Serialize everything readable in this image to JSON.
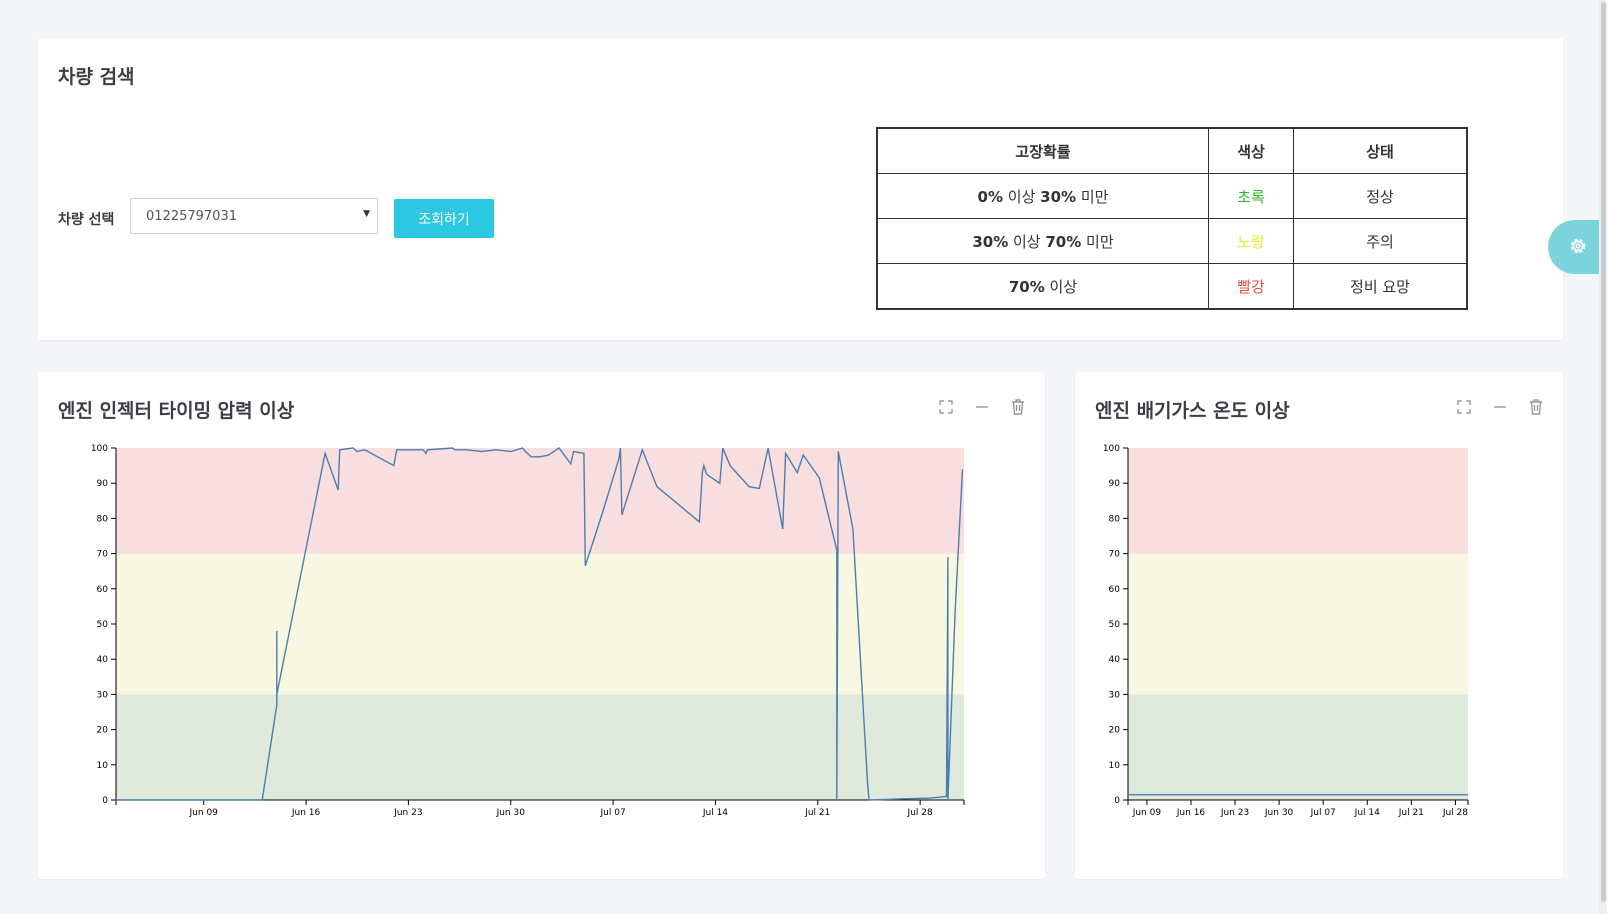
{
  "search": {
    "title": "차량 검색",
    "select_label": "차량 선택",
    "selected_vehicle": "01225797031",
    "query_button": "조회하기"
  },
  "status_table": {
    "headers": [
      "고장확률",
      "색상",
      "상태"
    ],
    "rows": [
      {
        "pre": "",
        "a": "0%",
        "mid": " 이상 ",
        "b": "30%",
        "post": " 미만",
        "color_label": "초록",
        "color": "#2fb82f",
        "state": "정상"
      },
      {
        "pre": "",
        "a": "30%",
        "mid": " 이상 ",
        "b": "70%",
        "post": " 미만",
        "color_label": "노랑",
        "color": "#e8e82a",
        "state": "주의"
      },
      {
        "pre": "",
        "a": "70%",
        "mid": " 이상",
        "b": "",
        "post": "",
        "color_label": "빨강",
        "color": "#e84b4b",
        "state": "정비 요망"
      }
    ]
  },
  "charts": [
    {
      "title": "엔진 인젝터 타이밍 압력 이상"
    },
    {
      "title": "엔진 배기가스 온도 이상"
    }
  ],
  "chart_data": [
    {
      "type": "line",
      "title": "엔진 인젝터 타이밍 압력 이상",
      "ylim": [
        0,
        100
      ],
      "yticks": [
        0,
        10,
        20,
        30,
        40,
        50,
        60,
        70,
        80,
        90,
        100
      ],
      "xlim": [
        "2018-06-03",
        "2018-07-31"
      ],
      "xticks": [
        "Jun 09",
        "Jun 16",
        "Jun 23",
        "Jun 30",
        "Jul 07",
        "Jul 14",
        "Jul 21",
        "Jul 28"
      ],
      "bands": [
        {
          "from": 0,
          "to": 30,
          "color": "#dfeadc"
        },
        {
          "from": 30,
          "to": 70,
          "color": "#f8f8e2"
        },
        {
          "from": 70,
          "to": 100,
          "color": "#f8dede"
        }
      ],
      "line_color": "#4a7fb0",
      "points": [
        [
          "2018-06-03",
          0
        ],
        [
          "2018-06-13",
          0
        ],
        [
          "2018-06-14",
          27
        ],
        [
          "2018-06-14",
          48
        ],
        [
          "2018-06-14",
          30
        ],
        [
          "2018-06-17.3",
          98.5
        ],
        [
          "2018-06-18.2",
          88
        ],
        [
          "2018-06-18.3",
          99.5
        ],
        [
          "2018-06-19.2",
          100
        ],
        [
          "2018-06-19.5",
          99
        ],
        [
          "2018-06-20",
          99.5
        ],
        [
          "2018-06-22",
          95
        ],
        [
          "2018-06-22.2",
          99.5
        ],
        [
          "2018-06-24",
          99.5
        ],
        [
          "2018-06-24.2",
          98.5
        ],
        [
          "2018-06-24.3",
          99.5
        ],
        [
          "2018-06-26",
          100
        ],
        [
          "2018-06-26.2",
          99.5
        ],
        [
          "2018-06-27",
          99.5
        ],
        [
          "2018-06-28",
          99
        ],
        [
          "2018-06-29",
          99.5
        ],
        [
          "2018-06-30",
          99
        ],
        [
          "2018-06-30.8",
          100
        ],
        [
          "2018-07-01",
          99
        ],
        [
          "2018-07-01.4",
          97.5
        ],
        [
          "2018-07-02",
          97.5
        ],
        [
          "2018-07-02.6",
          98
        ],
        [
          "2018-07-03.3",
          100
        ],
        [
          "2018-07-04.1",
          95.5
        ],
        [
          "2018-07-04.3",
          99
        ],
        [
          "2018-07-05",
          98.5
        ],
        [
          "2018-07-05.1",
          66.5
        ],
        [
          "2018-07-06.3",
          82
        ],
        [
          "2018-07-07.4",
          97
        ],
        [
          "2018-07-07.5",
          100
        ],
        [
          "2018-07-07.6",
          81
        ],
        [
          "2018-07-09",
          99.5
        ],
        [
          "2018-07-10",
          89
        ],
        [
          "2018-07-12.9",
          79
        ],
        [
          "2018-07-13.1",
          93
        ],
        [
          "2018-07-13.2",
          95
        ],
        [
          "2018-07-13.4",
          92.5
        ],
        [
          "2018-07-14.3",
          90
        ],
        [
          "2018-07-14.5",
          100
        ],
        [
          "2018-07-15",
          95
        ],
        [
          "2018-07-16.3",
          89
        ],
        [
          "2018-07-17",
          88.5
        ],
        [
          "2018-07-17.6",
          100
        ],
        [
          "2018-07-18.6",
          77
        ],
        [
          "2018-07-18.8",
          98.5
        ],
        [
          "2018-07-19.6",
          93
        ],
        [
          "2018-07-20",
          98
        ],
        [
          "2018-07-21.1",
          91.5
        ],
        [
          "2018-07-22.3",
          71
        ],
        [
          "2018-07-22.3",
          0
        ],
        [
          "2018-07-22.4",
          99
        ],
        [
          "2018-07-23.4",
          77
        ],
        [
          "2018-07-24.4",
          5
        ],
        [
          "2018-07-24.5",
          0
        ],
        [
          "2018-07-28.3",
          0.5
        ],
        [
          "2018-07-28.6",
          0.5
        ],
        [
          "2018-07-29.8",
          1
        ],
        [
          "2018-07-29.9",
          69
        ],
        [
          "2018-07-29.9",
          0
        ],
        [
          "2018-07-30.4",
          54
        ],
        [
          "2018-07-30.9",
          94
        ]
      ]
    },
    {
      "type": "line",
      "title": "엔진 배기가스 온도 이상",
      "ylim": [
        0,
        100
      ],
      "yticks": [
        0,
        10,
        20,
        30,
        40,
        50,
        60,
        70,
        80,
        90,
        100
      ],
      "xlim": [
        "2018-06-06",
        "2018-07-30"
      ],
      "xticks": [
        "Jun 09",
        "Jun 16",
        "Jun 23",
        "Jun 30",
        "Jul 07",
        "Jul 14",
        "Jul 21",
        "Jul 28"
      ],
      "bands": [
        {
          "from": 0,
          "to": 30,
          "color": "#dfeadc"
        },
        {
          "from": 30,
          "to": 70,
          "color": "#f8f8e2"
        },
        {
          "from": 70,
          "to": 100,
          "color": "#f8dede"
        }
      ],
      "line_color": "#4a7fb0",
      "points": [
        [
          "2018-06-06",
          1.5
        ],
        [
          "2018-07-30",
          1.5
        ]
      ]
    }
  ]
}
